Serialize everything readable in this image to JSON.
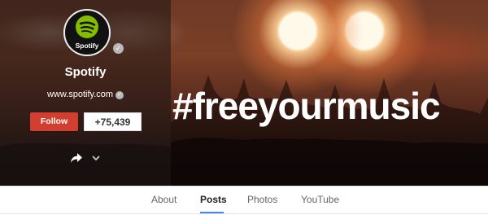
{
  "profile": {
    "logo_text": "Spotify",
    "name": "Spotify",
    "website": "www.spotify.com",
    "follow_label": "Follow",
    "follower_count": "+75,439"
  },
  "cover": {
    "hashtag": "#freeyourmusic"
  },
  "tabs": [
    {
      "label": "About",
      "active": false
    },
    {
      "label": "Posts",
      "active": true
    },
    {
      "label": "Photos",
      "active": false
    },
    {
      "label": "YouTube",
      "active": false
    }
  ],
  "colors": {
    "spotify_green": "#84bd00",
    "follow_red": "#d23f31",
    "tab_accent": "#4285f4"
  },
  "icons": {
    "verified": "check-circle",
    "share": "share-arrow",
    "more": "chevron-down"
  }
}
